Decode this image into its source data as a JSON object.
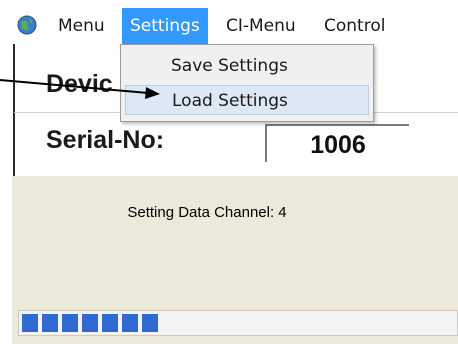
{
  "menubar": {
    "items": [
      {
        "label": "Menu"
      },
      {
        "label": "Settings",
        "active": true
      },
      {
        "label": "CI-Menu"
      },
      {
        "label": "Control"
      }
    ],
    "app_icon": "globe-icon"
  },
  "dropdown": {
    "items": [
      {
        "label": "Save Settings"
      },
      {
        "label": "Load Settings",
        "highlighted": true
      }
    ]
  },
  "device": {
    "device_label": "Devic",
    "serial_label": "Serial-No:",
    "serial_value": "1006"
  },
  "dialog": {
    "message": "Setting Data Channel:  4",
    "progress_segments_filled": 7
  },
  "colors": {
    "menu_highlight": "#3399ff",
    "progress": "#2f6ad0",
    "dialog_bg": "#ece9d8"
  }
}
